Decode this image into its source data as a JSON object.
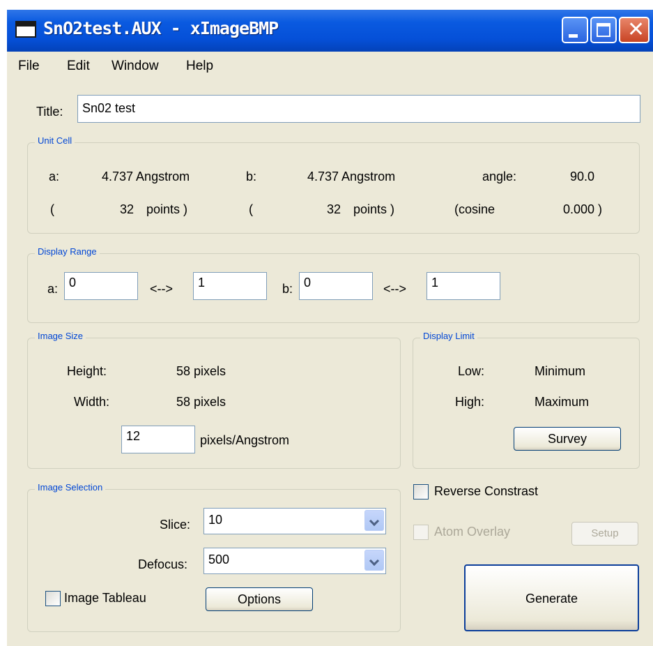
{
  "window": {
    "title": "SnO2test.AUX - xImageBMP"
  },
  "menu": [
    "File",
    "Edit",
    "Window",
    "Help"
  ],
  "title_field": {
    "label": "Title:",
    "value": "Sn02 test"
  },
  "unit_cell": {
    "legend": "Unit Cell",
    "a_label": "a:",
    "a_value": "4.737 Angstrom",
    "b_label": "b:",
    "b_value": "4.737 Angstrom",
    "angle_label": "angle:",
    "angle_value": "90.0",
    "a_points_open": "(",
    "a_points": "32",
    "a_points_close": "points )",
    "b_points_open": "(",
    "b_points": "32",
    "b_points_close": "points )",
    "cosine_label": "(cosine",
    "cosine_value": "0.000 )"
  },
  "display_range": {
    "legend": "Display Range",
    "a_label": "a:",
    "a_from": "0",
    "a_arrow": "<-->",
    "a_to": "1",
    "b_label": "b:",
    "b_from": "0",
    "b_arrow": "<-->",
    "b_to": "1"
  },
  "image_size": {
    "legend": "Image Size",
    "height_label": "Height:",
    "height_value": "58 pixels",
    "width_label": "Width:",
    "width_value": "58 pixels",
    "ppa_value": "12",
    "ppa_label": "pixels/Angstrom"
  },
  "display_limit": {
    "legend": "Display Limit",
    "low_label": "Low:",
    "low_value": "Minimum",
    "high_label": "High:",
    "high_value": "Maximum",
    "survey_button": "Survey"
  },
  "image_selection": {
    "legend": "Image Selection",
    "slice_label": "Slice:",
    "slice_value": "10",
    "defocus_label": "Defocus:",
    "defocus_value": "500",
    "tableau_label": "Image Tableau",
    "options_button": "Options"
  },
  "options": {
    "reverse_label": "Reverse Constrast",
    "overlay_label": "Atom Overlay",
    "setup_button": "Setup",
    "generate_button": "Generate"
  },
  "colors": {
    "titlebar": "#0a5ae0",
    "face": "#ece9d8",
    "group_legend": "#0046d5"
  }
}
